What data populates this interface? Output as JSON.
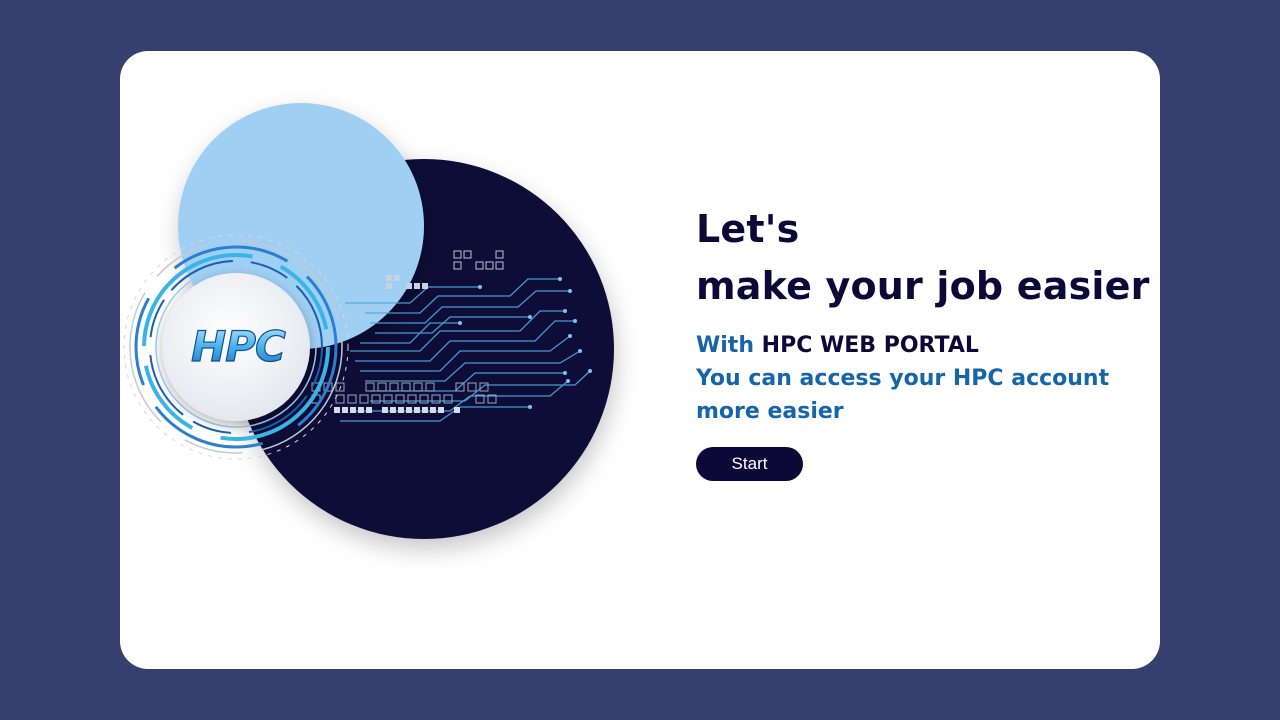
{
  "hero": {
    "logo_text": "HPC",
    "headline_line1": "Let's",
    "headline_line2": "make your job easier",
    "with_label": "With",
    "portal_name": "HPC WEB PORTAL",
    "description_line1": "You can access your HPC account",
    "description_line2": "more easier",
    "start_label": "Start"
  },
  "colors": {
    "page_background": "#35406f",
    "card_background": "#ffffff",
    "navy": "#0d0838",
    "light_blue": "#9fd0f3",
    "accent_blue": "#1565a8"
  },
  "icons": {
    "logo": "hpc-logo-icon",
    "circuit": "circuit-board-icon"
  }
}
